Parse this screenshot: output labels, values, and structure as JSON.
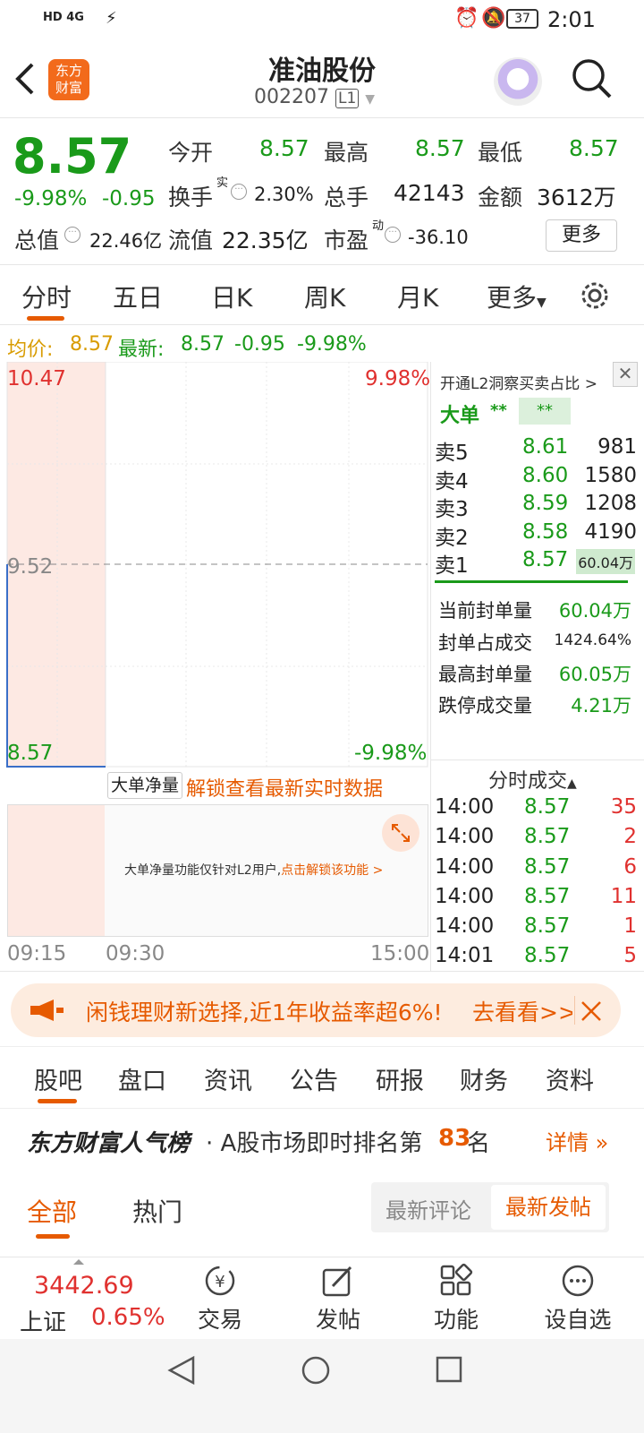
{
  "status_bar": {
    "left": "HD 4G",
    "time": "2:01",
    "battery": "37"
  },
  "header": {
    "logo_line1": "东方",
    "logo_line2": "财富",
    "title": "准油股份",
    "code": "002207",
    "level": "L1"
  },
  "quote": {
    "price": "8.57",
    "change_pct": "-9.98%",
    "change": "-0.95",
    "open_label": "今开",
    "open": "8.57",
    "high_label": "最高",
    "high": "8.57",
    "low_label": "最低",
    "low": "8.57",
    "turnover_label": "换手",
    "turnover_sup": "实",
    "turnover": "2.30%",
    "volume_label": "总手",
    "volume": "42143",
    "amount_label": "金额",
    "amount": "3612万",
    "mktcap_label": "总值",
    "mktcap": "22.46亿",
    "float_label": "流值",
    "float": "22.35亿",
    "pe_label": "市盈",
    "pe_sup": "动",
    "pe": "-36.10",
    "more": "更多"
  },
  "chart_tabs": [
    "分时",
    "五日",
    "日K",
    "周K",
    "月K",
    "更多"
  ],
  "avg_line": {
    "avg_label": "均价:",
    "avg": "8.57",
    "latest_label": "最新:",
    "latest": "8.57",
    "chg": "-0.95",
    "pct": "-9.98%"
  },
  "chart": {
    "y_top": "10.47",
    "y_mid": "9.52",
    "y_bottom": "8.57",
    "pct_top": "9.98%",
    "pct_bottom": "-9.98%",
    "x_start": "09:15",
    "x_mid": "09:30",
    "x_end": "15:00",
    "indicator": "大单净量",
    "unlock": "解锁查看最新实时数据",
    "notice": "大单净量功能仅针对L2用户,",
    "notice_link": "点击解锁该功能 >"
  },
  "book": {
    "l2_link": "开通L2洞察买卖占比 >",
    "big_label": "大单",
    "big_v1": "**",
    "big_v2": "**",
    "asks": [
      {
        "label": "卖5",
        "price": "8.61",
        "vol": "981"
      },
      {
        "label": "卖4",
        "price": "8.60",
        "vol": "1580"
      },
      {
        "label": "卖3",
        "price": "8.59",
        "vol": "1208"
      },
      {
        "label": "卖2",
        "price": "8.58",
        "vol": "4190"
      },
      {
        "label": "卖1",
        "price": "8.57",
        "vol": "60.04万"
      }
    ],
    "seal": [
      {
        "label": "当前封单量",
        "value": "60.04万"
      },
      {
        "label": "封单占成交",
        "value": "1424.64%"
      },
      {
        "label": "最高封单量",
        "value": "60.05万"
      },
      {
        "label": "跌停成交量",
        "value": "4.21万"
      }
    ],
    "ticks_title": "分时成交",
    "ticks": [
      {
        "time": "14:00",
        "price": "8.57",
        "vol": "35"
      },
      {
        "time": "14:00",
        "price": "8.57",
        "vol": "2"
      },
      {
        "time": "14:00",
        "price": "8.57",
        "vol": "6"
      },
      {
        "time": "14:00",
        "price": "8.57",
        "vol": "11"
      },
      {
        "time": "14:00",
        "price": "8.57",
        "vol": "1"
      },
      {
        "time": "14:01",
        "price": "8.57",
        "vol": "5"
      }
    ]
  },
  "banner": {
    "text": "闲钱理财新选择,近1年收益率超6%!",
    "cta": "去看看>>"
  },
  "bottom_tabs": [
    "股吧",
    "盘口",
    "资讯",
    "公告",
    "研报",
    "财务",
    "资料"
  ],
  "ranking": {
    "brand": "东方财富人气榜",
    "text": "· A股市场即时排名第",
    "rank": "83",
    "suffix": "名",
    "detail": "详情"
  },
  "forum": {
    "tab_all": "全部",
    "tab_hot": "热门",
    "sort_comment": "最新评论",
    "sort_post": "最新发帖"
  },
  "navbar": {
    "index_value": "3442.69",
    "index_name": "上证",
    "index_pct": "0.65%",
    "items": [
      "交易",
      "发帖",
      "功能",
      "设自选"
    ]
  },
  "colors": {
    "up": "#e0312f",
    "down": "#1a9a1a",
    "accent": "#e65a00"
  }
}
